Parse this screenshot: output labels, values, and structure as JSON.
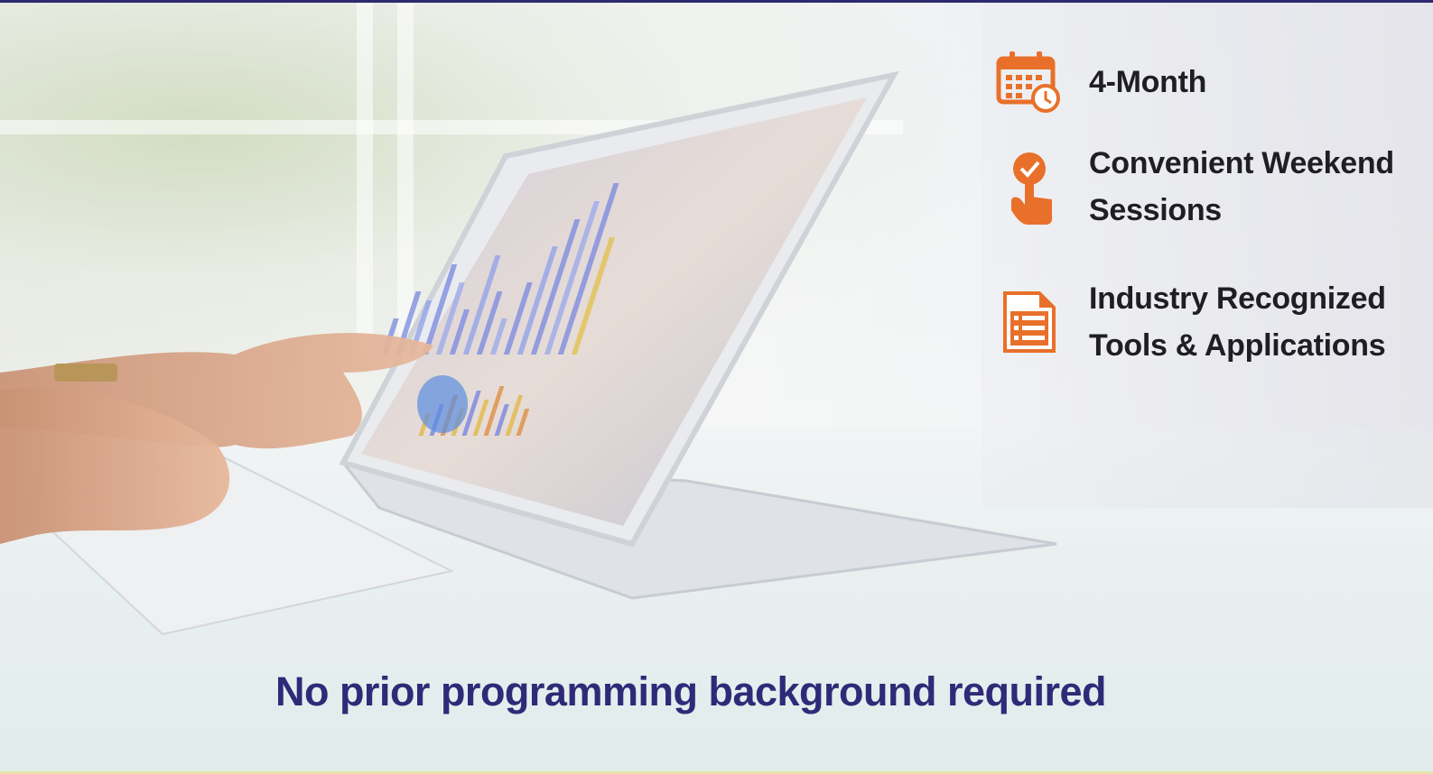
{
  "features": [
    {
      "icon": "calendar-clock-icon",
      "label": "4-Month"
    },
    {
      "icon": "hand-pointer-check-icon",
      "label_line1": "Convenient Weekend",
      "label_line2": "Sessions"
    },
    {
      "icon": "document-list-icon",
      "label_line1": "Industry Recognized",
      "label_line2": "Tools & Applications"
    }
  ],
  "tagline": "No prior programming background required",
  "colors": {
    "accent_orange": "#e8702a",
    "tagline_purple": "#2f2a78",
    "top_border": "#2e2a6f",
    "feature_text": "#1e1e24"
  },
  "background_image": "person-using-laptop-with-analytics-charts"
}
